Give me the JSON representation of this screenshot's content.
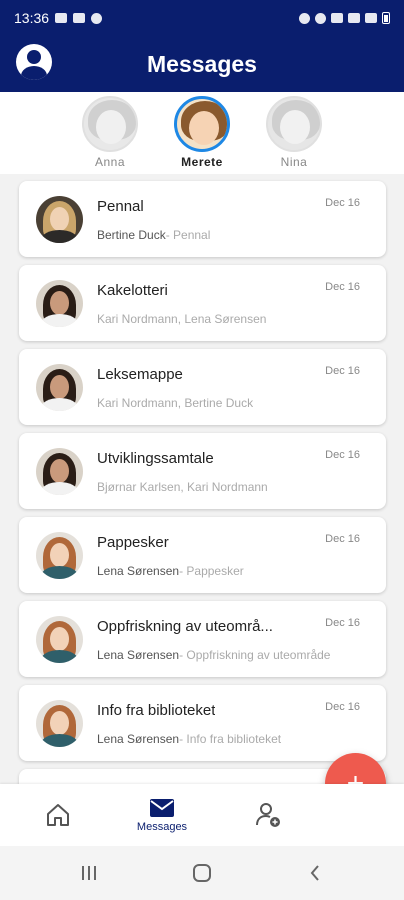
{
  "status_bar": {
    "time": "13:36"
  },
  "header": {
    "title": "Messages"
  },
  "children": [
    {
      "name": "Anna",
      "selected": false
    },
    {
      "name": "Merete",
      "selected": true
    },
    {
      "name": "Nina",
      "selected": false
    }
  ],
  "messages": [
    {
      "subject": "Pennal",
      "date": "Dec 16",
      "senders": "Bertine Duck",
      "preview": "- Pennal",
      "recipients": ""
    },
    {
      "subject": "Kakelotteri",
      "date": "Dec 16",
      "senders": "",
      "preview": "",
      "recipients": "Kari Nordmann, Lena Sørensen"
    },
    {
      "subject": "Leksemappe",
      "date": "Dec 16",
      "senders": "",
      "preview": "",
      "recipients": "Kari Nordmann, Bertine Duck"
    },
    {
      "subject": "Utviklingssamtale",
      "date": "Dec 16",
      "senders": "",
      "preview": "",
      "recipients": "Bjørnar Karlsen, Kari Nordmann"
    },
    {
      "subject": "Pappesker",
      "date": "Dec 16",
      "senders": "Lena Sørensen",
      "preview": "- Pappesker",
      "recipients": ""
    },
    {
      "subject": "Oppfriskning av uteområ...",
      "date": "Dec 16",
      "senders": "Lena Sørensen",
      "preview": "- Oppfriskning av uteområde",
      "recipients": ""
    },
    {
      "subject": "Info fra biblioteket",
      "date": "Dec 16",
      "senders": "Lena Sørensen",
      "preview": "- Info fra biblioteket",
      "recipients": ""
    }
  ],
  "fab": {
    "label": "+"
  },
  "bottom_nav": {
    "home_icon": "home-icon",
    "messages_label": "Messages",
    "contacts_icon": "person-add-icon"
  },
  "colors": {
    "primary": "#0a1e6e",
    "accent": "#ee5a4e",
    "selected_ring": "#1e88e5"
  }
}
